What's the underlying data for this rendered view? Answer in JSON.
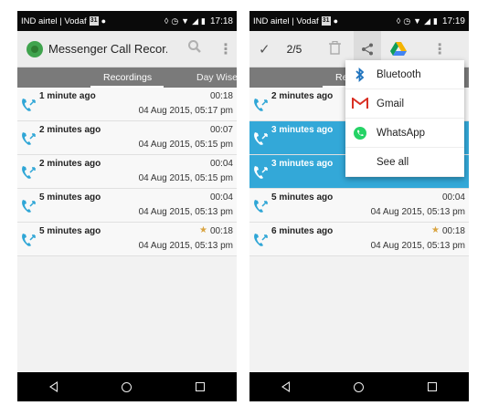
{
  "status": {
    "carrier": "IND airtel | Vodaf",
    "calendar_badge": "31",
    "left_time": "17:18",
    "right_time": "17:19"
  },
  "left": {
    "app_title": "Messenger Call Recor...",
    "tabs": {
      "recordings": "Recordings",
      "day_wise": "Day Wise"
    },
    "rows": [
      {
        "caller": "1 minute ago",
        "duration": "00:18",
        "date": "04 Aug 2015, 05:17 pm",
        "starred": false
      },
      {
        "caller": "2 minutes ago",
        "duration": "00:07",
        "date": "04 Aug 2015, 05:15 pm",
        "starred": false
      },
      {
        "caller": "2 minutes ago",
        "duration": "00:04",
        "date": "04 Aug 2015, 05:15 pm",
        "starred": false
      },
      {
        "caller": "5 minutes ago",
        "duration": "00:04",
        "date": "04 Aug 2015, 05:13 pm",
        "starred": false
      },
      {
        "caller": "5 minutes ago",
        "duration": "00:18",
        "date": "04 Aug 2015, 05:13 pm",
        "starred": true
      }
    ]
  },
  "right": {
    "selection_count": "2/5",
    "tabs": {
      "recordings": "Re",
      "day_wise": ""
    },
    "rows": [
      {
        "caller": "2 minutes ago",
        "duration": "",
        "date": "",
        "selected": false,
        "starred": false
      },
      {
        "caller": "3 minutes ago",
        "duration": "",
        "date": "",
        "selected": true,
        "starred": false
      },
      {
        "caller": "3 minutes ago",
        "duration": "",
        "date": "",
        "selected": true,
        "starred": false
      },
      {
        "caller": "5 minutes ago",
        "duration": "00:04",
        "date": "04 Aug 2015, 05:13 pm",
        "selected": false,
        "starred": false
      },
      {
        "caller": "6 minutes ago",
        "duration": "00:18",
        "date": "04 Aug 2015, 05:13 pm",
        "selected": false,
        "starred": true
      }
    ],
    "share_menu": [
      {
        "label": "Bluetooth",
        "icon": "bluetooth-icon"
      },
      {
        "label": "Gmail",
        "icon": "gmail-icon"
      },
      {
        "label": "WhatsApp",
        "icon": "whatsapp-icon"
      },
      {
        "label": "See all",
        "icon": ""
      }
    ]
  },
  "colors": {
    "selected_row": "#33a8d8",
    "tab_bar": "#7a7a7a",
    "call_icon": "#2fa6d6"
  }
}
